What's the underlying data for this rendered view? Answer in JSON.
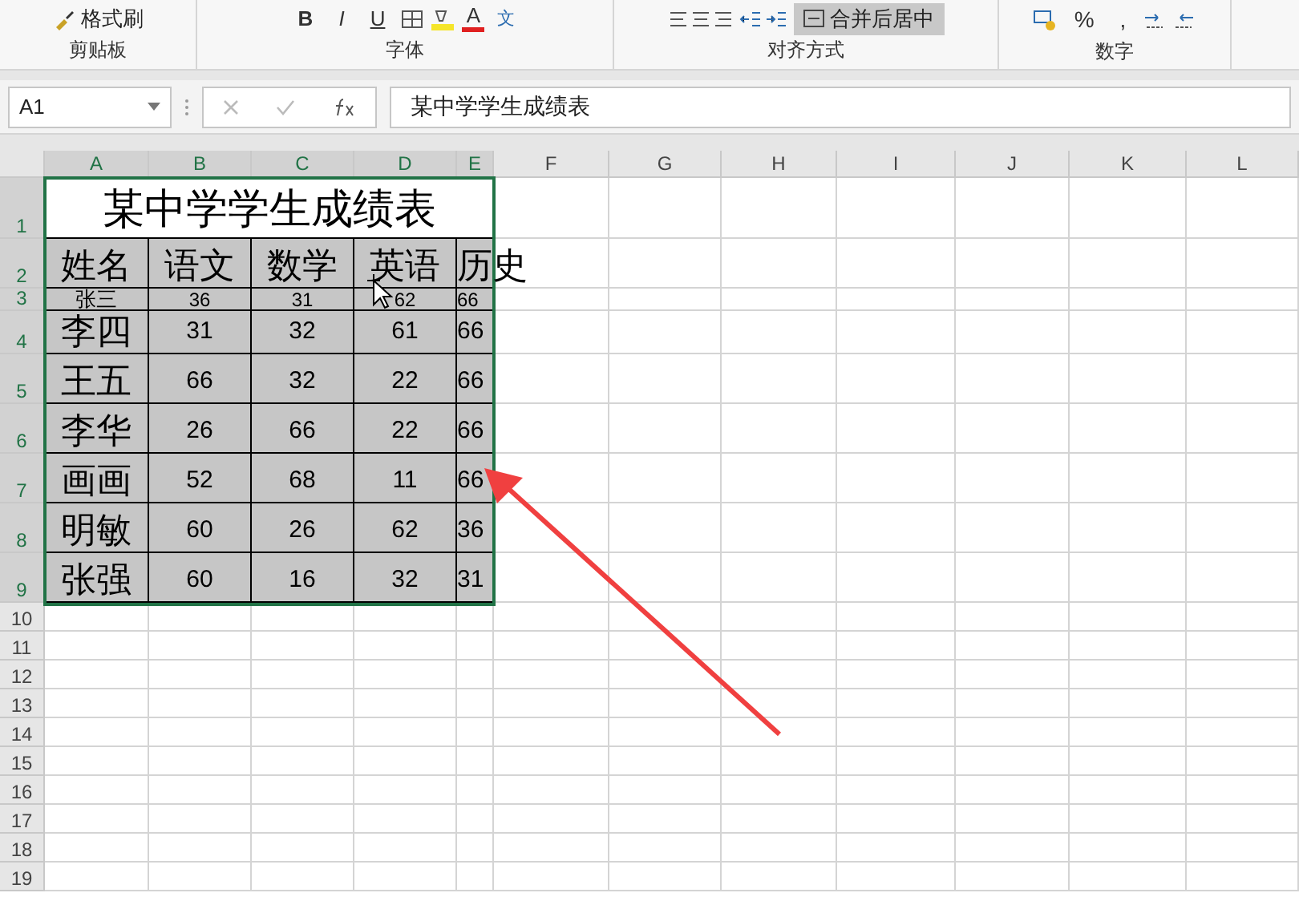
{
  "ribbon": {
    "groups": [
      {
        "label": "剪贴板",
        "items": [
          {
            "kind": "brush",
            "label": "格式刷"
          }
        ]
      },
      {
        "label": "字体",
        "items": [
          {
            "kind": "bold",
            "label": "B"
          },
          {
            "kind": "italic",
            "label": "I"
          },
          {
            "kind": "underline",
            "label": "U"
          },
          {
            "kind": "border"
          },
          {
            "kind": "fill"
          },
          {
            "kind": "fontcolor",
            "label": "A"
          },
          {
            "kind": "phonetic",
            "label": "文"
          }
        ]
      },
      {
        "label": "对齐方式",
        "items": [
          {
            "kind": "align"
          },
          {
            "kind": "indent"
          },
          {
            "kind": "merge",
            "label": "合并后居中"
          }
        ]
      },
      {
        "label": "数字",
        "items": [
          {
            "kind": "currency"
          },
          {
            "kind": "text",
            "label": "%"
          },
          {
            "kind": "text",
            "label": ","
          },
          {
            "kind": "decimals"
          }
        ]
      }
    ]
  },
  "formula_bar": {
    "name_box": "A1",
    "value": "某中学学生成绩表"
  },
  "sheet": {
    "columns": [
      {
        "label": "A",
        "selected": true
      },
      {
        "label": "B",
        "selected": true
      },
      {
        "label": "C",
        "selected": true
      },
      {
        "label": "D",
        "selected": true
      },
      {
        "label": "E",
        "selected": true
      },
      {
        "label": "F",
        "selected": false
      },
      {
        "label": "G",
        "selected": false
      },
      {
        "label": "H",
        "selected": false
      },
      {
        "label": "I",
        "selected": false
      },
      {
        "label": "J",
        "selected": false
      },
      {
        "label": "K",
        "selected": false
      },
      {
        "label": "L",
        "selected": false
      }
    ],
    "rows": [
      {
        "label": "1",
        "selected": true
      },
      {
        "label": "2",
        "selected": true
      },
      {
        "label": "3",
        "selected": true
      },
      {
        "label": "4",
        "selected": true
      },
      {
        "label": "5",
        "selected": true
      },
      {
        "label": "6",
        "selected": true
      },
      {
        "label": "7",
        "selected": true
      },
      {
        "label": "8",
        "selected": true
      },
      {
        "label": "9",
        "selected": true
      },
      {
        "label": "10",
        "selected": false
      },
      {
        "label": "11",
        "selected": false
      },
      {
        "label": "12",
        "selected": false
      },
      {
        "label": "13",
        "selected": false
      },
      {
        "label": "14",
        "selected": false
      },
      {
        "label": "15",
        "selected": false
      },
      {
        "label": "16",
        "selected": false
      },
      {
        "label": "17",
        "selected": false
      },
      {
        "label": "18",
        "selected": false
      },
      {
        "label": "19",
        "selected": false
      }
    ],
    "title": "某中学学生成绩表",
    "header": [
      "姓名",
      "语文",
      "数学",
      "英语",
      "历史"
    ],
    "records": [
      [
        "张三",
        "36",
        "31",
        "62",
        "66"
      ],
      [
        "李四",
        "31",
        "32",
        "61",
        "66"
      ],
      [
        "王五",
        "66",
        "32",
        "22",
        "66"
      ],
      [
        "李华",
        "26",
        "66",
        "22",
        "66"
      ],
      [
        "画画",
        "52",
        "68",
        "11",
        "66"
      ],
      [
        "明敏",
        "60",
        "26",
        "62",
        "36"
      ],
      [
        "张强",
        "60",
        "16",
        "32",
        "31"
      ]
    ]
  }
}
